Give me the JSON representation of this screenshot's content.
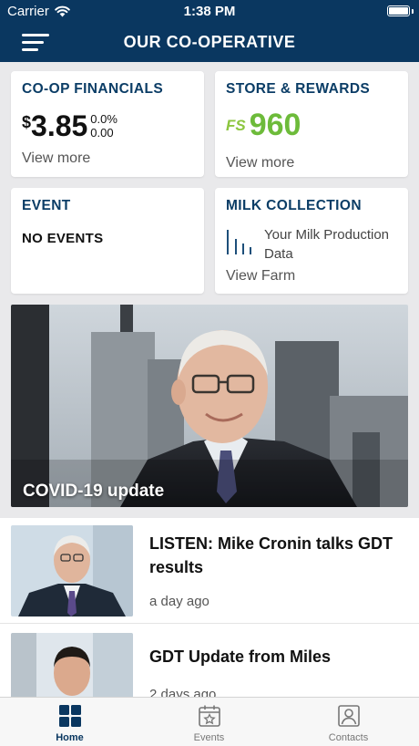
{
  "status_bar": {
    "carrier": "Carrier",
    "time": "1:38 PM"
  },
  "nav": {
    "title": "OUR CO-OPERATIVE"
  },
  "cards": {
    "financials": {
      "title": "CO-OP FINANCIALS",
      "currency": "$",
      "price": "3.85",
      "change_pct": "0.0%",
      "change_abs": "0.00",
      "link": "View more"
    },
    "store": {
      "title": "STORE & REWARDS",
      "logo": "FS",
      "points": "960",
      "link": "View more"
    },
    "event": {
      "title": "EVENT",
      "status": "NO EVENTS"
    },
    "milk": {
      "title": "MILK COLLECTION",
      "text": "Your Milk Production Data",
      "link": "View Farm"
    }
  },
  "hero": {
    "caption": "COVID-19 update"
  },
  "news": [
    {
      "title": "LISTEN: Mike Cronin talks GDT results",
      "time": "a day ago"
    },
    {
      "title": "GDT Update from Miles",
      "time": "2 days ago"
    }
  ],
  "tabs": [
    {
      "label": "Home",
      "icon": "grid-icon",
      "active": true
    },
    {
      "label": "Events",
      "icon": "calendar-star-icon",
      "active": false
    },
    {
      "label": "Contacts",
      "icon": "contact-card-icon",
      "active": false
    }
  ],
  "colors": {
    "navy": "#0a3760",
    "title_blue": "#0b3d66",
    "green": "#6dbb3a"
  }
}
